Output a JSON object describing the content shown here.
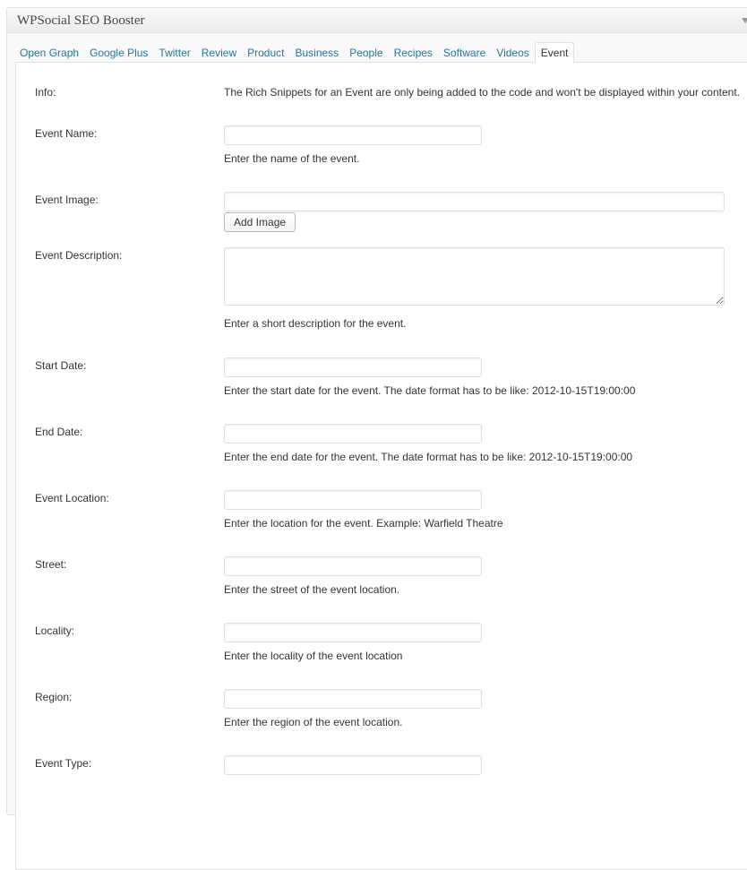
{
  "metabox": {
    "title": "WPSocial SEO Booster",
    "toggle_icon": "triangle-down-icon"
  },
  "tabs": [
    {
      "label": "Open Graph",
      "active": false
    },
    {
      "label": "Google Plus",
      "active": false
    },
    {
      "label": "Twitter",
      "active": false
    },
    {
      "label": "Review",
      "active": false
    },
    {
      "label": "Product",
      "active": false
    },
    {
      "label": "Business",
      "active": false
    },
    {
      "label": "People",
      "active": false
    },
    {
      "label": "Recipes",
      "active": false
    },
    {
      "label": "Software",
      "active": false
    },
    {
      "label": "Videos",
      "active": false
    },
    {
      "label": "Event",
      "active": true
    }
  ],
  "form": {
    "info": {
      "label": "Info:",
      "text": "The Rich Snippets for an Event are only being added to the code and won't be displayed within your content."
    },
    "event_name": {
      "label": "Event Name:",
      "value": "",
      "description": "Enter the name of the event."
    },
    "event_image": {
      "label": "Event Image:",
      "value": "",
      "button": "Add Image"
    },
    "event_description": {
      "label": "Event Description:",
      "value": "",
      "description": "Enter a short description for the event."
    },
    "start_date": {
      "label": "Start Date:",
      "value": "",
      "description": "Enter the start date for the event. The date format has to be like: 2012-10-15T19:00:00"
    },
    "end_date": {
      "label": "End Date:",
      "value": "",
      "description": "Enter the end date for the event. The date format has to be like: 2012-10-15T19:00:00"
    },
    "event_location": {
      "label": "Event Location:",
      "value": "",
      "description": "Enter the location for the event. Example: Warfield Theatre"
    },
    "street": {
      "label": "Street:",
      "value": "",
      "description": "Enter the street of the event location."
    },
    "locality": {
      "label": "Locality:",
      "value": "",
      "description": "Enter the locality of the event location"
    },
    "region": {
      "label": "Region:",
      "value": "",
      "description": "Enter the region of the event location."
    },
    "event_type": {
      "label": "Event Type:",
      "value": ""
    }
  },
  "colors": {
    "link": "#21759b",
    "text": "#333333",
    "border": "#dfdfdf"
  }
}
